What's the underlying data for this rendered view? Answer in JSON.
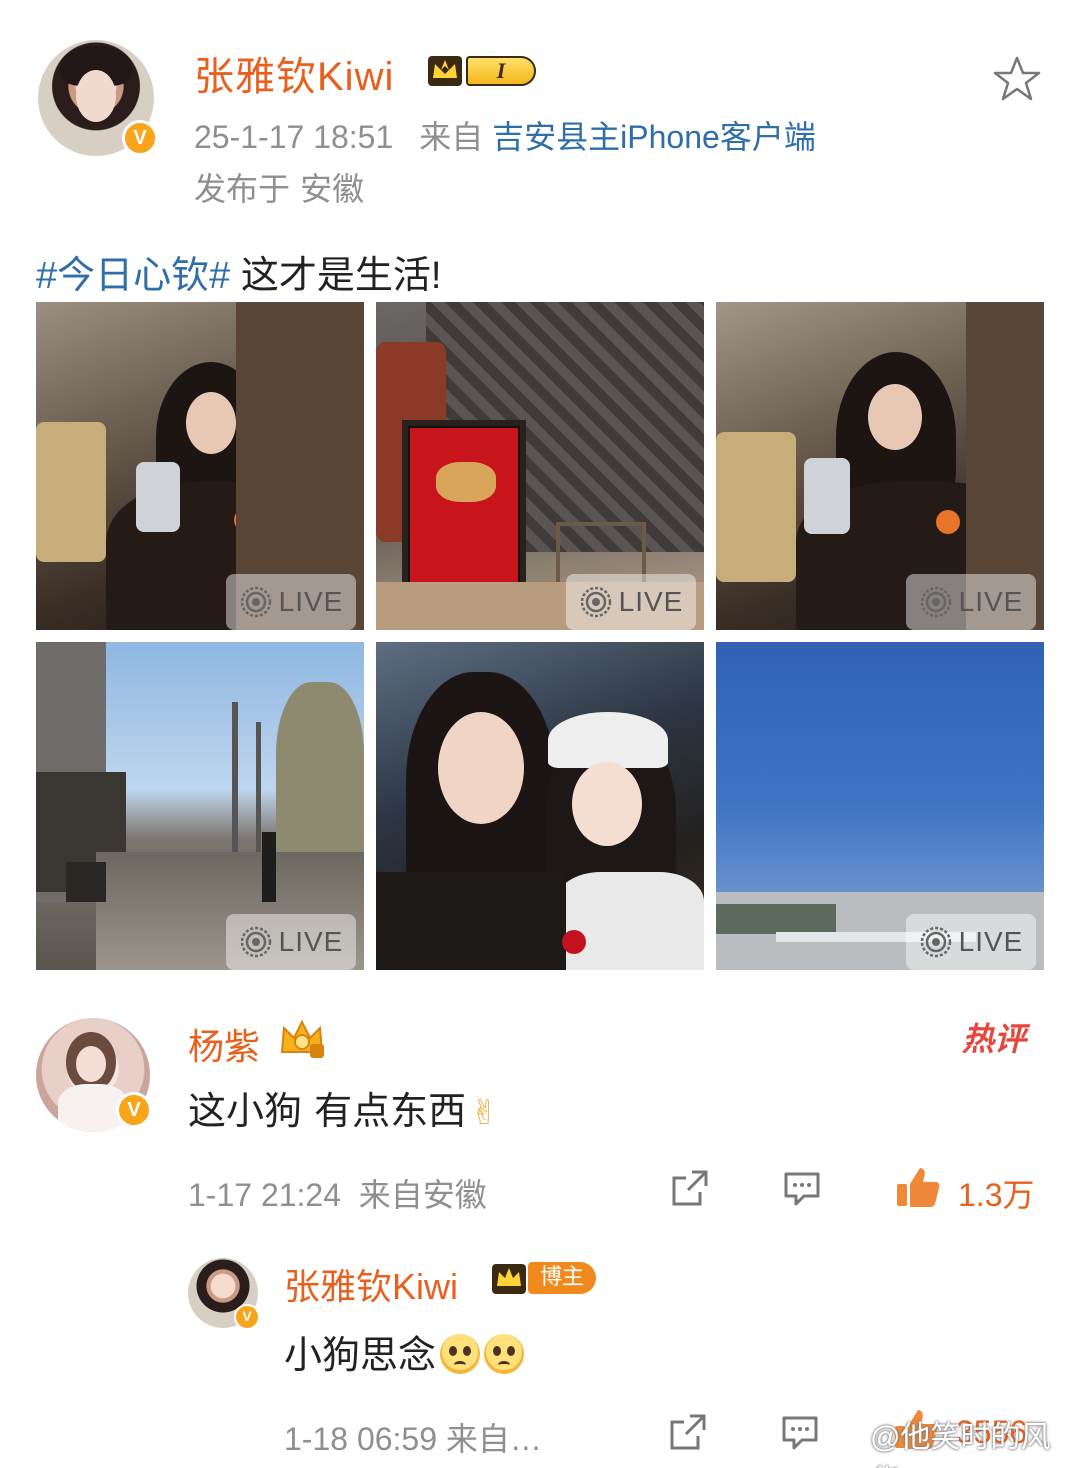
{
  "post": {
    "author_name": "张雅钦Kiwi",
    "level_label": "I",
    "time": "25-1-17 18:51",
    "source_prefix": "来自",
    "source": "吉安县主iPhone客户端",
    "location": "发布于 安徽",
    "hashtag": "#今日心钦#",
    "text": " 这才是生活!",
    "photos": [
      {
        "live_label": "LIVE"
      },
      {
        "live_label": "LIVE"
      },
      {
        "live_label": "LIVE"
      },
      {
        "live_label": "LIVE"
      },
      {
        "live_label": ""
      },
      {
        "live_label": "LIVE"
      }
    ]
  },
  "comments": [
    {
      "author_name": "杨紫",
      "hot_label": "热评",
      "text": "这小狗 有点东西",
      "time": "1-17 21:24",
      "location": "来自安徽",
      "likes": "1.3万"
    }
  ],
  "reply": {
    "author_name": "张雅钦Kiwi",
    "role_label": "博主",
    "text": "小狗思念",
    "time": "1-18 06:59",
    "location": "来自…",
    "likes": "3556"
  },
  "watermark": "@他笑时的风华",
  "colors": {
    "name_orange": "#e8601d",
    "link_blue": "#2f6ea8",
    "meta_gray": "#8f8f8f",
    "hot_red": "#e8453c"
  }
}
